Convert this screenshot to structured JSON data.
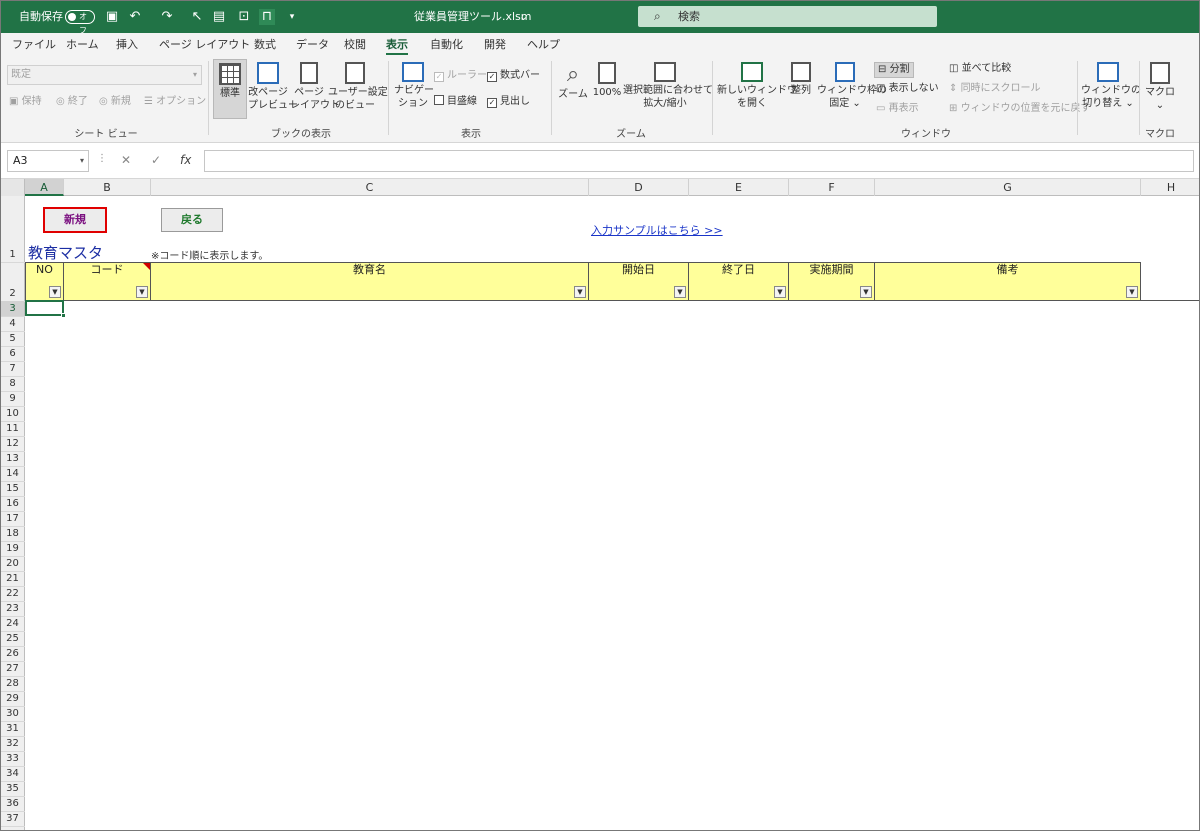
{
  "titlebar": {
    "autosave_label": "自動保存",
    "autosave_state": "オフ",
    "file_name": "従業員管理ツール.xlsm",
    "file_dropdown": "⌄",
    "search_placeholder": "検索"
  },
  "menu": [
    "ファイル",
    "ホーム",
    "挿入",
    "ページ レイアウト",
    "数式",
    "データ",
    "校閲",
    "表示",
    "自動化",
    "開発",
    "ヘルプ"
  ],
  "ribbon": {
    "sheetview": {
      "dropdown_value": "既定",
      "keep": "保持",
      "exit": "終了",
      "new": "新規",
      "options": "オプション",
      "group": "シート ビュー"
    },
    "bookview": {
      "normal": "標準",
      "pagebreak_1": "改ページ",
      "pagebreak_2": "プレビュー",
      "pagelayout_1": "ページ",
      "pagelayout_2": "レイアウト",
      "custom_1": "ユーザー設定",
      "custom_2": "のビュー",
      "group": "ブックの表示"
    },
    "show": {
      "nav_1": "ナビゲー",
      "nav_2": "ション",
      "ruler": "ルーラー",
      "formulabar": "数式バー",
      "gridlines": "目盛線",
      "headings": "見出し",
      "group": "表示"
    },
    "zoom": {
      "zoom": "ズーム",
      "hundred": "100%",
      "fit_1": "選択範囲に合わせて",
      "fit_2": "拡大/縮小",
      "group": "ズーム"
    },
    "window": {
      "newwin_1": "新しいウィンドウ",
      "newwin_2": "を開く",
      "arrange": "整列",
      "freeze_1": "ウィンドウ枠の",
      "freeze_2": "固定 ⌄",
      "split": "分割",
      "hide": "表示しない",
      "unhide": "再表示",
      "sidebyside": "並べて比較",
      "syncscroll": "同時にスクロール",
      "resetpos": "ウィンドウの位置を元に戻す",
      "switch_1": "ウィンドウの",
      "switch_2": "切り替え ⌄",
      "group": "ウィンドウ"
    },
    "macro": {
      "macro_1": "マクロ",
      "macro_2": "⌄",
      "group": "マクロ"
    }
  },
  "formula_bar": {
    "name_box": "A3",
    "fx": "fx",
    "value": ""
  },
  "grid": {
    "columns": [
      "A",
      "B",
      "C",
      "D",
      "E",
      "F",
      "G",
      "H"
    ],
    "rows": [
      "1",
      "2",
      "3",
      "4",
      "5",
      "6",
      "7",
      "8",
      "9",
      "10",
      "11",
      "12",
      "13",
      "14",
      "15",
      "16",
      "17",
      "18",
      "19",
      "20",
      "21",
      "22",
      "23",
      "24",
      "25",
      "26",
      "27",
      "28",
      "29",
      "30",
      "31",
      "32",
      "33",
      "34",
      "35",
      "36",
      "37"
    ]
  },
  "sheet": {
    "btn_new": "新規",
    "btn_back": "戻る",
    "sample_link": "入力サンプルはこちら >>",
    "title": "教育マスタ",
    "note": "※コード順に表示します。",
    "headers": [
      "NO",
      "コード",
      "教育名",
      "開始日",
      "終了日",
      "実施期間",
      "備考"
    ]
  },
  "colors": {
    "excel_green": "#217346",
    "header_fill": "#ffff9a",
    "title_blue": "#1c2ea3",
    "link_blue": "#1a35c8",
    "button_red_border": "#e00000"
  }
}
